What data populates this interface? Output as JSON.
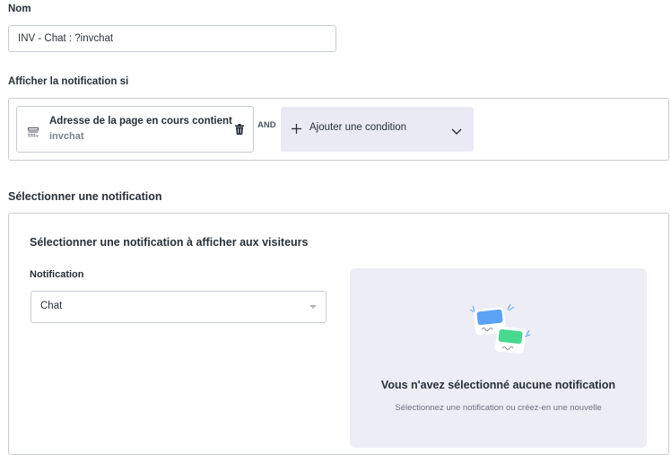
{
  "form": {
    "name_label": "Nom",
    "name_value": "INV - Chat : ?invchat",
    "display_if_label": "Afficher la notification si",
    "condition": {
      "title": "Adresse de la page en cours contient",
      "value": "invchat",
      "icon": "web-page-icon"
    },
    "and_label": "AND",
    "add_condition_label": "Ajouter une condition"
  },
  "notification_section": {
    "title": "Sélectionner une notification",
    "subtitle": "Sélectionner une notification à afficher aux visiteurs",
    "field_label": "Notification",
    "selected_value": "Chat",
    "empty_state": {
      "title": "Vous n'avez sélectionné aucune notification",
      "subtitle": "Sélectionnez une notification ou créez-en une nouvelle"
    }
  },
  "colors": {
    "border": "#c7cbd3",
    "panel_bg": "#ededf6",
    "add_condition_bg": "#e9eaf4",
    "illustration_blue": "#5aa2f4",
    "illustration_green": "#47d98f"
  }
}
